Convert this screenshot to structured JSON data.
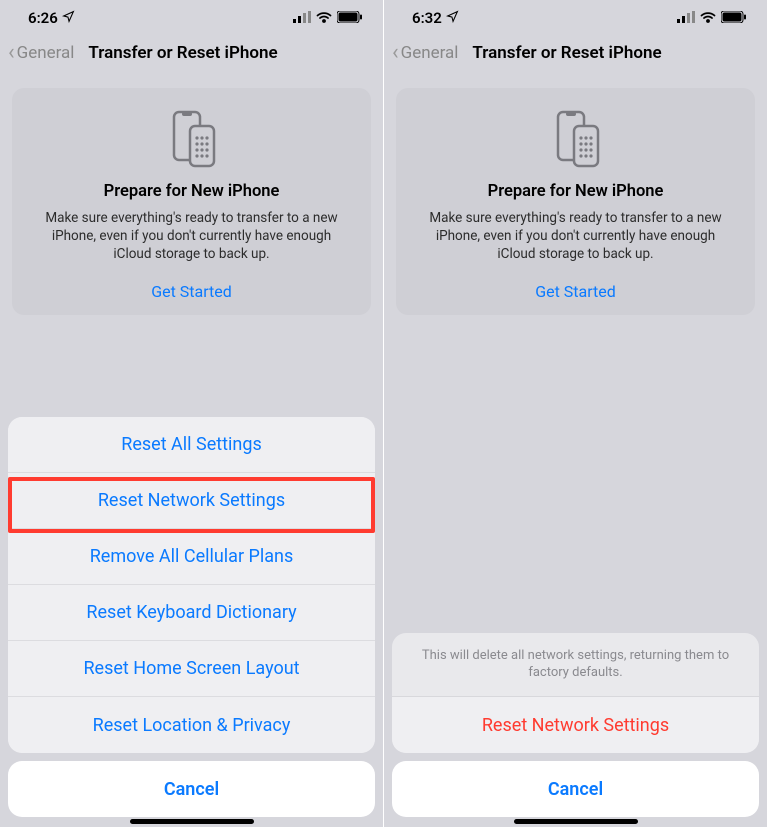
{
  "left": {
    "status": {
      "time": "6:26"
    },
    "nav": {
      "back": "General",
      "title": "Transfer or Reset iPhone"
    },
    "card": {
      "title": "Prepare for New iPhone",
      "desc": "Make sure everything's ready to transfer to a new iPhone, even if you don't currently have enough iCloud storage to back up.",
      "link": "Get Started"
    },
    "sheet": {
      "items": [
        "Reset All Settings",
        "Reset Network Settings",
        "Remove All Cellular Plans",
        "Reset Keyboard Dictionary",
        "Reset Home Screen Layout",
        "Reset Location & Privacy"
      ],
      "cancel": "Cancel"
    },
    "highlightedIndex": 1
  },
  "right": {
    "status": {
      "time": "6:32"
    },
    "nav": {
      "back": "General",
      "title": "Transfer or Reset iPhone"
    },
    "card": {
      "title": "Prepare for New iPhone",
      "desc": "Make sure everything's ready to transfer to a new iPhone, even if you don't currently have enough iCloud storage to back up.",
      "link": "Get Started"
    },
    "confirm": {
      "message": "This will delete all network settings, returning them to factory defaults.",
      "action": "Reset Network Settings",
      "cancel": "Cancel"
    }
  },
  "colors": {
    "link": "#0a7aff",
    "destructive": "#ff3b30",
    "highlight": "#ff3b30"
  }
}
